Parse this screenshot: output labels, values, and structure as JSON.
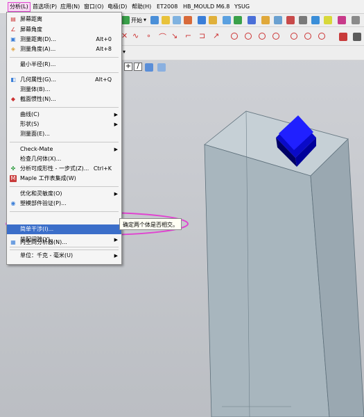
{
  "menubar": {
    "items": [
      "分析(L)",
      "首选项(P)",
      "应用(N)",
      "窗口(O)",
      "电极(D)",
      "帮助(H)",
      "ET2008",
      "HB_MOULD M6.8",
      "YSUG"
    ]
  },
  "toolbar": {
    "start_label": "开始"
  },
  "menu": {
    "items": [
      {
        "label": "屏幕距离",
        "icon": "ruler-icon"
      },
      {
        "label": "屏幕角度",
        "icon": "angle-icon"
      },
      {
        "label": "测量距离(D)...",
        "shortcut": "Alt+0",
        "icon": "measure-distance-icon"
      },
      {
        "label": "测量角度(A)...",
        "shortcut": "Alt+8",
        "icon": "measure-angle-icon"
      },
      {
        "label": "最小半径(R)..."
      },
      {
        "label": "几何属性(G)...",
        "shortcut": "Alt+Q",
        "icon": "geometry-icon"
      },
      {
        "label": "测量体(B)..."
      },
      {
        "label": "截面惯性(N)...",
        "icon": "section-icon"
      },
      {
        "label": "曲线(C)",
        "submenu": true
      },
      {
        "label": "形状(S)",
        "submenu": true
      },
      {
        "label": "测量面(E)..."
      },
      {
        "label": "Check-Mate",
        "submenu": true
      },
      {
        "label": "检查几何体(X)..."
      },
      {
        "label": "分析可成形性 - 一步式(Z)...",
        "shortcut": "Ctrl+K",
        "icon": "formability-icon"
      },
      {
        "label": "Maple 工作表集成(W)",
        "icon": "maple-icon"
      },
      {
        "label": "优化和灵敏度(O)",
        "submenu": true
      },
      {
        "label": "塑模部件验证(P)...",
        "icon": "mold-icon"
      },
      {
        "label": "简单干涉(I)...",
        "highlighted": true
      },
      {
        "label": "装配间隙(Y)",
        "submenu": true
      },
      {
        "label": "内空间分析器(N)...",
        "icon": "inner-space-icon"
      },
      {
        "label": "单位：千克 - 毫米(U)",
        "submenu": true
      }
    ]
  },
  "tooltip": {
    "text": "确定两个体是否相交。"
  },
  "colors": {
    "highlight": "#3b6ec9",
    "annotation": "#e044d0",
    "box_face": "#a9b6bf",
    "cube": "#1010e0"
  }
}
